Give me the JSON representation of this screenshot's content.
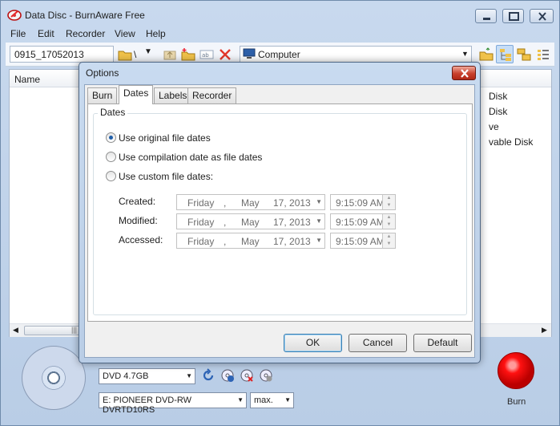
{
  "window": {
    "title": "Data Disc - BurnAware Free"
  },
  "menubar": {
    "file": "File",
    "edit": "Edit",
    "recorder": "Recorder",
    "view": "View",
    "help": "Help"
  },
  "toolbar": {
    "disc_label": "0915_17052013",
    "path_separator": "\\",
    "location": "Computer"
  },
  "content": {
    "column_name": "Name",
    "scroll_grip": "|||",
    "bg_items": [
      "Disk",
      "Disk",
      "ve",
      "vable Disk"
    ]
  },
  "bottom": {
    "disc_type": "DVD 4.7GB",
    "drive": "E: PIONEER DVD-RW DVRTD10RS",
    "speed": "max.",
    "burn_label": "Burn"
  },
  "dialog": {
    "title": "Options",
    "tabs": [
      "Burn",
      "Dates",
      "Labels",
      "Recorder"
    ],
    "active_tab": "Dates",
    "group_label": "Dates",
    "radio_original": "Use original file dates",
    "radio_compilation": "Use compilation date as file dates",
    "radio_custom": "Use custom file dates:",
    "selected_radio": "original",
    "rows": [
      {
        "label": "Created:",
        "weekday": "Friday",
        "sep": ",",
        "month": "May",
        "day_year": "17, 2013",
        "time": "9:15:09 AM"
      },
      {
        "label": "Modified:",
        "weekday": "Friday",
        "sep": ",",
        "month": "May",
        "day_year": "17, 2013",
        "time": "9:15:09 AM"
      },
      {
        "label": "Accessed:",
        "weekday": "Friday",
        "sep": ",",
        "month": "May",
        "day_year": "17, 2013",
        "time": "9:15:09 AM"
      }
    ],
    "ok_label": "OK",
    "cancel_label": "Cancel",
    "default_label": "Default"
  }
}
